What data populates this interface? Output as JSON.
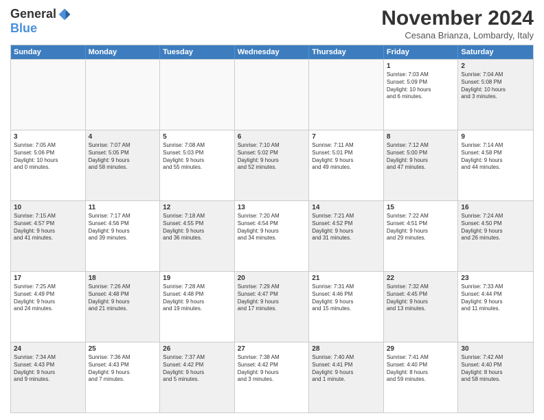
{
  "header": {
    "logo_general": "General",
    "logo_blue": "Blue",
    "month_title": "November 2024",
    "location": "Cesana Brianza, Lombardy, Italy"
  },
  "days_of_week": [
    "Sunday",
    "Monday",
    "Tuesday",
    "Wednesday",
    "Thursday",
    "Friday",
    "Saturday"
  ],
  "weeks": [
    [
      {
        "day": "",
        "empty": true
      },
      {
        "day": "",
        "empty": true
      },
      {
        "day": "",
        "empty": true
      },
      {
        "day": "",
        "empty": true
      },
      {
        "day": "",
        "empty": true
      },
      {
        "day": "1",
        "lines": [
          "Sunrise: 7:03 AM",
          "Sunset: 5:09 PM",
          "Daylight: 10 hours",
          "and 6 minutes."
        ]
      },
      {
        "day": "2",
        "lines": [
          "Sunrise: 7:04 AM",
          "Sunset: 5:08 PM",
          "Daylight: 10 hours",
          "and 3 minutes."
        ],
        "shaded": true
      }
    ],
    [
      {
        "day": "3",
        "lines": [
          "Sunrise: 7:05 AM",
          "Sunset: 5:06 PM",
          "Daylight: 10 hours",
          "and 0 minutes."
        ]
      },
      {
        "day": "4",
        "lines": [
          "Sunrise: 7:07 AM",
          "Sunset: 5:05 PM",
          "Daylight: 9 hours",
          "and 58 minutes."
        ],
        "shaded": true
      },
      {
        "day": "5",
        "lines": [
          "Sunrise: 7:08 AM",
          "Sunset: 5:03 PM",
          "Daylight: 9 hours",
          "and 55 minutes."
        ]
      },
      {
        "day": "6",
        "lines": [
          "Sunrise: 7:10 AM",
          "Sunset: 5:02 PM",
          "Daylight: 9 hours",
          "and 52 minutes."
        ],
        "shaded": true
      },
      {
        "day": "7",
        "lines": [
          "Sunrise: 7:11 AM",
          "Sunset: 5:01 PM",
          "Daylight: 9 hours",
          "and 49 minutes."
        ]
      },
      {
        "day": "8",
        "lines": [
          "Sunrise: 7:12 AM",
          "Sunset: 5:00 PM",
          "Daylight: 9 hours",
          "and 47 minutes."
        ],
        "shaded": true
      },
      {
        "day": "9",
        "lines": [
          "Sunrise: 7:14 AM",
          "Sunset: 4:58 PM",
          "Daylight: 9 hours",
          "and 44 minutes."
        ]
      }
    ],
    [
      {
        "day": "10",
        "lines": [
          "Sunrise: 7:15 AM",
          "Sunset: 4:57 PM",
          "Daylight: 9 hours",
          "and 41 minutes."
        ],
        "shaded": true
      },
      {
        "day": "11",
        "lines": [
          "Sunrise: 7:17 AM",
          "Sunset: 4:56 PM",
          "Daylight: 9 hours",
          "and 39 minutes."
        ]
      },
      {
        "day": "12",
        "lines": [
          "Sunrise: 7:18 AM",
          "Sunset: 4:55 PM",
          "Daylight: 9 hours",
          "and 36 minutes."
        ],
        "shaded": true
      },
      {
        "day": "13",
        "lines": [
          "Sunrise: 7:20 AM",
          "Sunset: 4:54 PM",
          "Daylight: 9 hours",
          "and 34 minutes."
        ]
      },
      {
        "day": "14",
        "lines": [
          "Sunrise: 7:21 AM",
          "Sunset: 4:52 PM",
          "Daylight: 9 hours",
          "and 31 minutes."
        ],
        "shaded": true
      },
      {
        "day": "15",
        "lines": [
          "Sunrise: 7:22 AM",
          "Sunset: 4:51 PM",
          "Daylight: 9 hours",
          "and 29 minutes."
        ]
      },
      {
        "day": "16",
        "lines": [
          "Sunrise: 7:24 AM",
          "Sunset: 4:50 PM",
          "Daylight: 9 hours",
          "and 26 minutes."
        ],
        "shaded": true
      }
    ],
    [
      {
        "day": "17",
        "lines": [
          "Sunrise: 7:25 AM",
          "Sunset: 4:49 PM",
          "Daylight: 9 hours",
          "and 24 minutes."
        ]
      },
      {
        "day": "18",
        "lines": [
          "Sunrise: 7:26 AM",
          "Sunset: 4:48 PM",
          "Daylight: 9 hours",
          "and 21 minutes."
        ],
        "shaded": true
      },
      {
        "day": "19",
        "lines": [
          "Sunrise: 7:28 AM",
          "Sunset: 4:48 PM",
          "Daylight: 9 hours",
          "and 19 minutes."
        ]
      },
      {
        "day": "20",
        "lines": [
          "Sunrise: 7:29 AM",
          "Sunset: 4:47 PM",
          "Daylight: 9 hours",
          "and 17 minutes."
        ],
        "shaded": true
      },
      {
        "day": "21",
        "lines": [
          "Sunrise: 7:31 AM",
          "Sunset: 4:46 PM",
          "Daylight: 9 hours",
          "and 15 minutes."
        ]
      },
      {
        "day": "22",
        "lines": [
          "Sunrise: 7:32 AM",
          "Sunset: 4:45 PM",
          "Daylight: 9 hours",
          "and 13 minutes."
        ],
        "shaded": true
      },
      {
        "day": "23",
        "lines": [
          "Sunrise: 7:33 AM",
          "Sunset: 4:44 PM",
          "Daylight: 9 hours",
          "and 11 minutes."
        ]
      }
    ],
    [
      {
        "day": "24",
        "lines": [
          "Sunrise: 7:34 AM",
          "Sunset: 4:43 PM",
          "Daylight: 9 hours",
          "and 9 minutes."
        ],
        "shaded": true
      },
      {
        "day": "25",
        "lines": [
          "Sunrise: 7:36 AM",
          "Sunset: 4:43 PM",
          "Daylight: 9 hours",
          "and 7 minutes."
        ]
      },
      {
        "day": "26",
        "lines": [
          "Sunrise: 7:37 AM",
          "Sunset: 4:42 PM",
          "Daylight: 9 hours",
          "and 5 minutes."
        ],
        "shaded": true
      },
      {
        "day": "27",
        "lines": [
          "Sunrise: 7:38 AM",
          "Sunset: 4:42 PM",
          "Daylight: 9 hours",
          "and 3 minutes."
        ]
      },
      {
        "day": "28",
        "lines": [
          "Sunrise: 7:40 AM",
          "Sunset: 4:41 PM",
          "Daylight: 9 hours",
          "and 1 minute."
        ],
        "shaded": true
      },
      {
        "day": "29",
        "lines": [
          "Sunrise: 7:41 AM",
          "Sunset: 4:40 PM",
          "Daylight: 8 hours",
          "and 59 minutes."
        ]
      },
      {
        "day": "30",
        "lines": [
          "Sunrise: 7:42 AM",
          "Sunset: 4:40 PM",
          "Daylight: 8 hours",
          "and 58 minutes."
        ],
        "shaded": true
      }
    ]
  ]
}
